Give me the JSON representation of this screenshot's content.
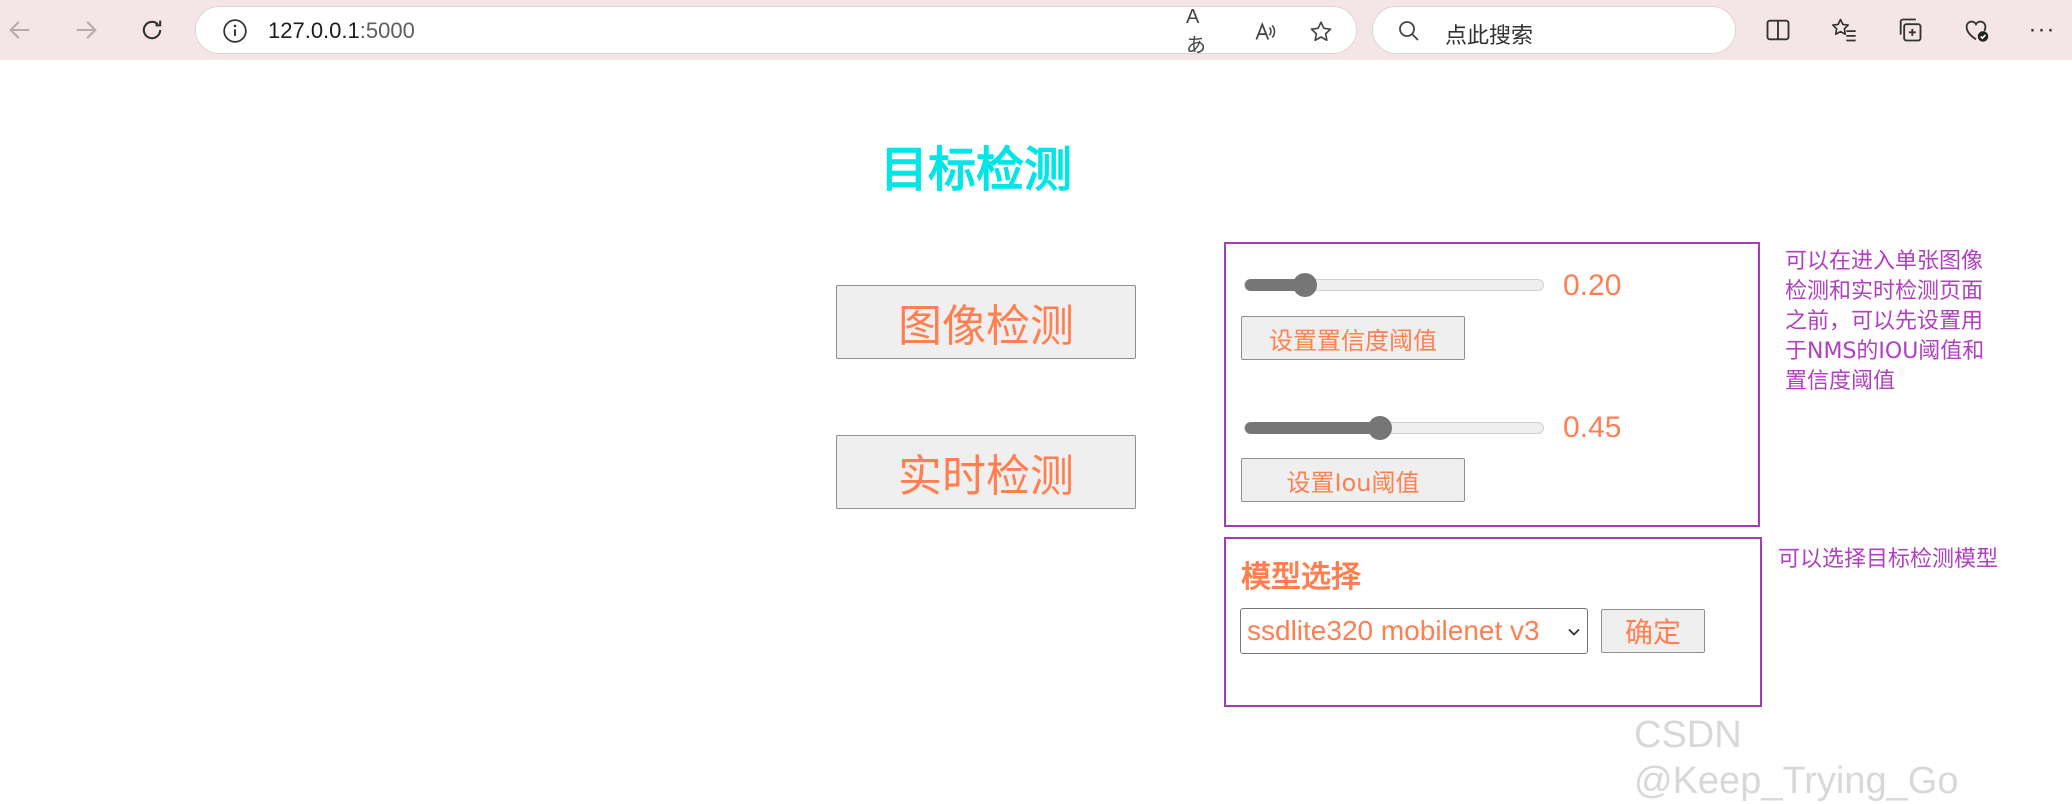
{
  "browser": {
    "url_host": "127.0.0.1",
    "url_port": ":5000",
    "search_placeholder": "点此搜索",
    "read_aloud_label": "Aあ",
    "translate_label": "A",
    "more_label": "···"
  },
  "page": {
    "title": "目标检测",
    "image_detect_button": "图像检测",
    "realtime_detect_button": "实时检测"
  },
  "thresholds": {
    "confidence_value": "0.20",
    "confidence_fraction": 0.2,
    "confidence_button": "设置置信度阈值",
    "iou_value": "0.45",
    "iou_fraction": 0.45,
    "iou_button": "设置Iou阈值",
    "note": "可以在进入单张图像检测和实时检测页面之前，可以先设置用于NMS的IOU阈值和置信度阈值"
  },
  "model": {
    "heading": "模型选择",
    "selected": "ssdlite320 mobilenet v3",
    "confirm_button": "确定",
    "note": "可以选择目标检测模型"
  },
  "watermark": "CSDN @Keep_Trying_Go",
  "colors": {
    "title": "#00e5e5",
    "accent": "#ff7f50",
    "panel_border": "#a040b0",
    "note": "#b040c0"
  }
}
